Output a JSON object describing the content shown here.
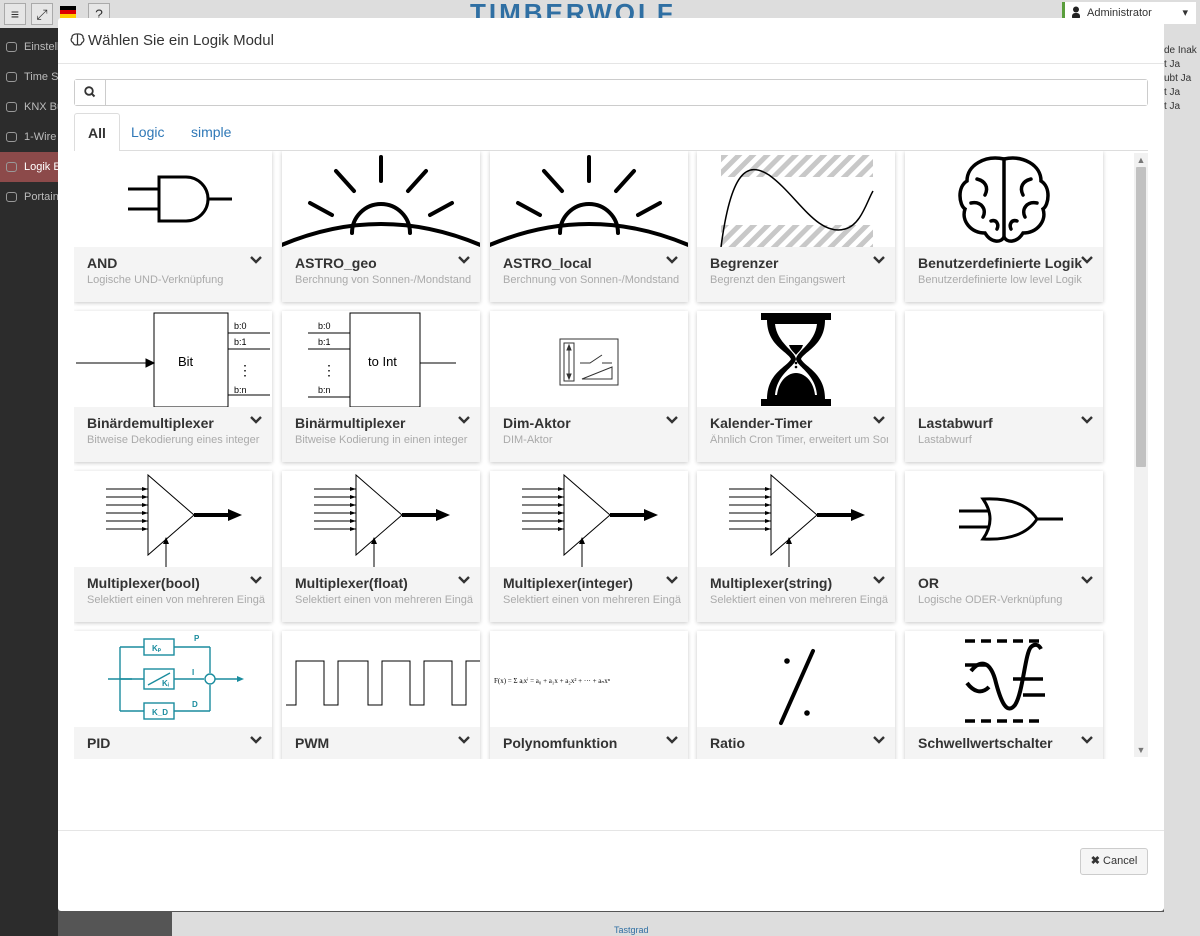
{
  "app": {
    "brand": "TIMBERWOLF",
    "user": "Administrator",
    "sidebar": [
      {
        "label": "Einstellungen",
        "active": false
      },
      {
        "label": "Time Series",
        "active": false
      },
      {
        "label": "KNX Bus",
        "active": false
      },
      {
        "label": "1-Wire",
        "active": false
      },
      {
        "label": "Logik Editor",
        "active": true
      },
      {
        "label": "Portainer",
        "active": false
      }
    ],
    "status_lines": [
      "de Inak",
      "t Ja",
      "ubt Ja",
      "t Ja",
      "t Ja"
    ],
    "bottom_link": "Tastgrad"
  },
  "modal": {
    "title": "Wählen Sie ein Logik Modul",
    "search_value": "",
    "tabs": [
      {
        "label": "All",
        "active": true
      },
      {
        "label": "Logic",
        "active": false
      },
      {
        "label": "simple",
        "active": false
      }
    ],
    "cancel_label": "Cancel",
    "modules": [
      {
        "title": "AND",
        "desc": "Logische UND-Verknüpfung",
        "icon": "and-gate-icon"
      },
      {
        "title": "ASTRO_geo",
        "desc": "Berchnung von Sonnen-/Mondstand",
        "icon": "sunrise-icon"
      },
      {
        "title": "ASTRO_local",
        "desc": "Berchnung von Sonnen-/Mondstand",
        "icon": "sunrise-icon"
      },
      {
        "title": "Begrenzer",
        "desc": "Begrenzt den Eingangswert",
        "icon": "limiter-curve-icon"
      },
      {
        "title": "Benutzerdefinierte Logik",
        "desc": "Benutzerdefinierte low level Logik",
        "icon": "brain-icon"
      },
      {
        "title": "Binärdemultiplexer",
        "desc": "Bitweise Dekodierung eines integer",
        "icon": "binary-demux-icon"
      },
      {
        "title": "Binärmultiplexer",
        "desc": "Bitweise Kodierung in einen integer",
        "icon": "binary-mux-icon"
      },
      {
        "title": "Dim-Aktor",
        "desc": "DIM-Aktor",
        "icon": "dimmer-icon"
      },
      {
        "title": "Kalender-Timer",
        "desc": "Ähnlich Cron Timer, erweitert um Sonne",
        "icon": "hourglass-icon"
      },
      {
        "title": "Lastabwurf",
        "desc": "Lastabwurf",
        "icon": "blank-icon"
      },
      {
        "title": "Multiplexer(bool)",
        "desc": "Selektiert einen von mehreren Eingängen",
        "icon": "multiplexer-icon"
      },
      {
        "title": "Multiplexer(float)",
        "desc": "Selektiert einen von mehreren Eingängen",
        "icon": "multiplexer-icon"
      },
      {
        "title": "Multiplexer(integer)",
        "desc": "Selektiert einen von mehreren Eingängen",
        "icon": "multiplexer-icon"
      },
      {
        "title": "Multiplexer(string)",
        "desc": "Selektiert einen von mehreren Eingängen",
        "icon": "multiplexer-icon"
      },
      {
        "title": "OR",
        "desc": "Logische ODER-Verknüpfung",
        "icon": "or-gate-icon"
      },
      {
        "title": "PID",
        "desc": "",
        "icon": "pid-controller-icon"
      },
      {
        "title": "PWM",
        "desc": "",
        "icon": "pwm-wave-icon"
      },
      {
        "title": "Polynomfunktion",
        "desc": "",
        "icon": "polynomial-formula-icon"
      },
      {
        "title": "Ratio",
        "desc": "",
        "icon": "ratio-icon"
      },
      {
        "title": "Schwellwertschalter",
        "desc": "",
        "icon": "threshold-switch-icon"
      }
    ],
    "icon_labels": {
      "bit": "Bit",
      "to_int": "to Int",
      "b0": "b:0",
      "b1": "b:1",
      "bn": "b:n",
      "kp": "Kₚ",
      "ki": "Kᵢ",
      "kd": "K_D",
      "p": "P",
      "i": "I",
      "d": "D",
      "formula": "F(x) = Σ aᵢxⁱ = a₀ + a₁x + a₂x² + ··· + aₙxⁿ"
    }
  }
}
